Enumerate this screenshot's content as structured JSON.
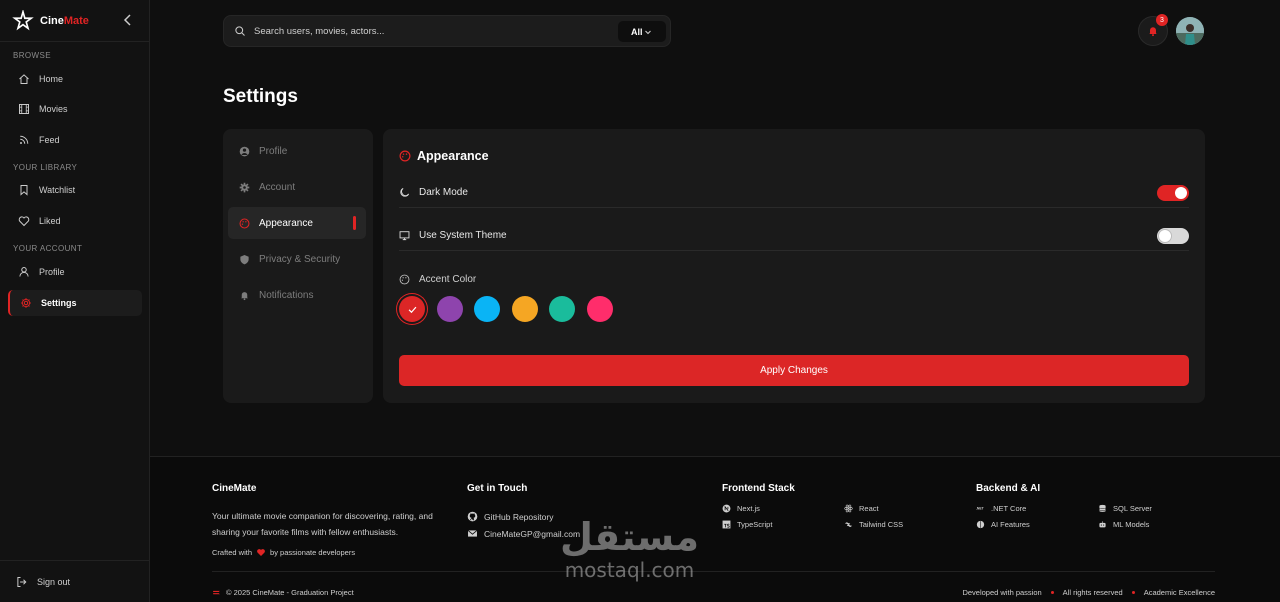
{
  "brand": {
    "name_part1": "Cine",
    "name_part2": "Mate",
    "accent": "#e02424"
  },
  "sidebar": {
    "sections": [
      {
        "label": "BROWSE"
      },
      {
        "label": "YOUR LIBRARY"
      },
      {
        "label": "YOUR ACCOUNT"
      }
    ],
    "items": [
      {
        "label": "Home",
        "icon": "home-icon"
      },
      {
        "label": "Movies",
        "icon": "film-icon"
      },
      {
        "label": "Feed",
        "icon": "rss-icon"
      },
      {
        "label": "Watchlist",
        "icon": "bookmark-icon"
      },
      {
        "label": "Liked",
        "icon": "heart-icon"
      },
      {
        "label": "Profile",
        "icon": "user-icon"
      },
      {
        "label": "Settings",
        "icon": "gear-icon",
        "active": true
      }
    ],
    "signout": "Sign out"
  },
  "header": {
    "search_placeholder": "Search users, movies, actors...",
    "filter": "All",
    "notifications_count": "3"
  },
  "page_title": "Settings",
  "settings_nav": [
    {
      "label": "Profile",
      "icon": "user-circle-icon"
    },
    {
      "label": "Account",
      "icon": "gear-icon"
    },
    {
      "label": "Appearance",
      "icon": "palette-icon",
      "active": true
    },
    {
      "label": "Privacy & Security",
      "icon": "shield-icon"
    },
    {
      "label": "Notifications",
      "icon": "bell-icon"
    }
  ],
  "appearance": {
    "title": "Appearance",
    "dark_mode": {
      "label": "Dark Mode",
      "enabled": true
    },
    "system_theme": {
      "label": "Use System Theme",
      "enabled": false
    },
    "accent_label": "Accent Color",
    "accent_colors": [
      "#dc2626",
      "#8e44ad",
      "#0ab4f5",
      "#f5a623",
      "#1abc9c",
      "#ff2d6b"
    ],
    "selected_accent": "#dc2626",
    "apply_label": "Apply Changes"
  },
  "footer": {
    "brand": "CineMate",
    "description": "Your ultimate movie companion for discovering, rating, and sharing your favorite films with fellow enthusiasts.",
    "crafted_prefix": "Crafted with",
    "crafted_suffix": "by passionate developers",
    "contact_title": "Get in Touch",
    "github": "GitHub Repository",
    "email": "CineMateGP@gmail.com",
    "frontend_title": "Frontend Stack",
    "frontend": [
      "Next.js",
      "React",
      "TypeScript",
      "Tailwind CSS"
    ],
    "backend_title": "Backend & AI",
    "backend": [
      ".NET Core",
      "SQL Server",
      "AI Features",
      "ML Models"
    ],
    "copyright": "© 2025 CineMate - Graduation Project",
    "bottom_links": [
      "Developed with passion",
      "All rights reserved",
      "Academic Excellence"
    ]
  },
  "watermark": {
    "arabic": "مستقل",
    "latin": "mostaql.com"
  }
}
